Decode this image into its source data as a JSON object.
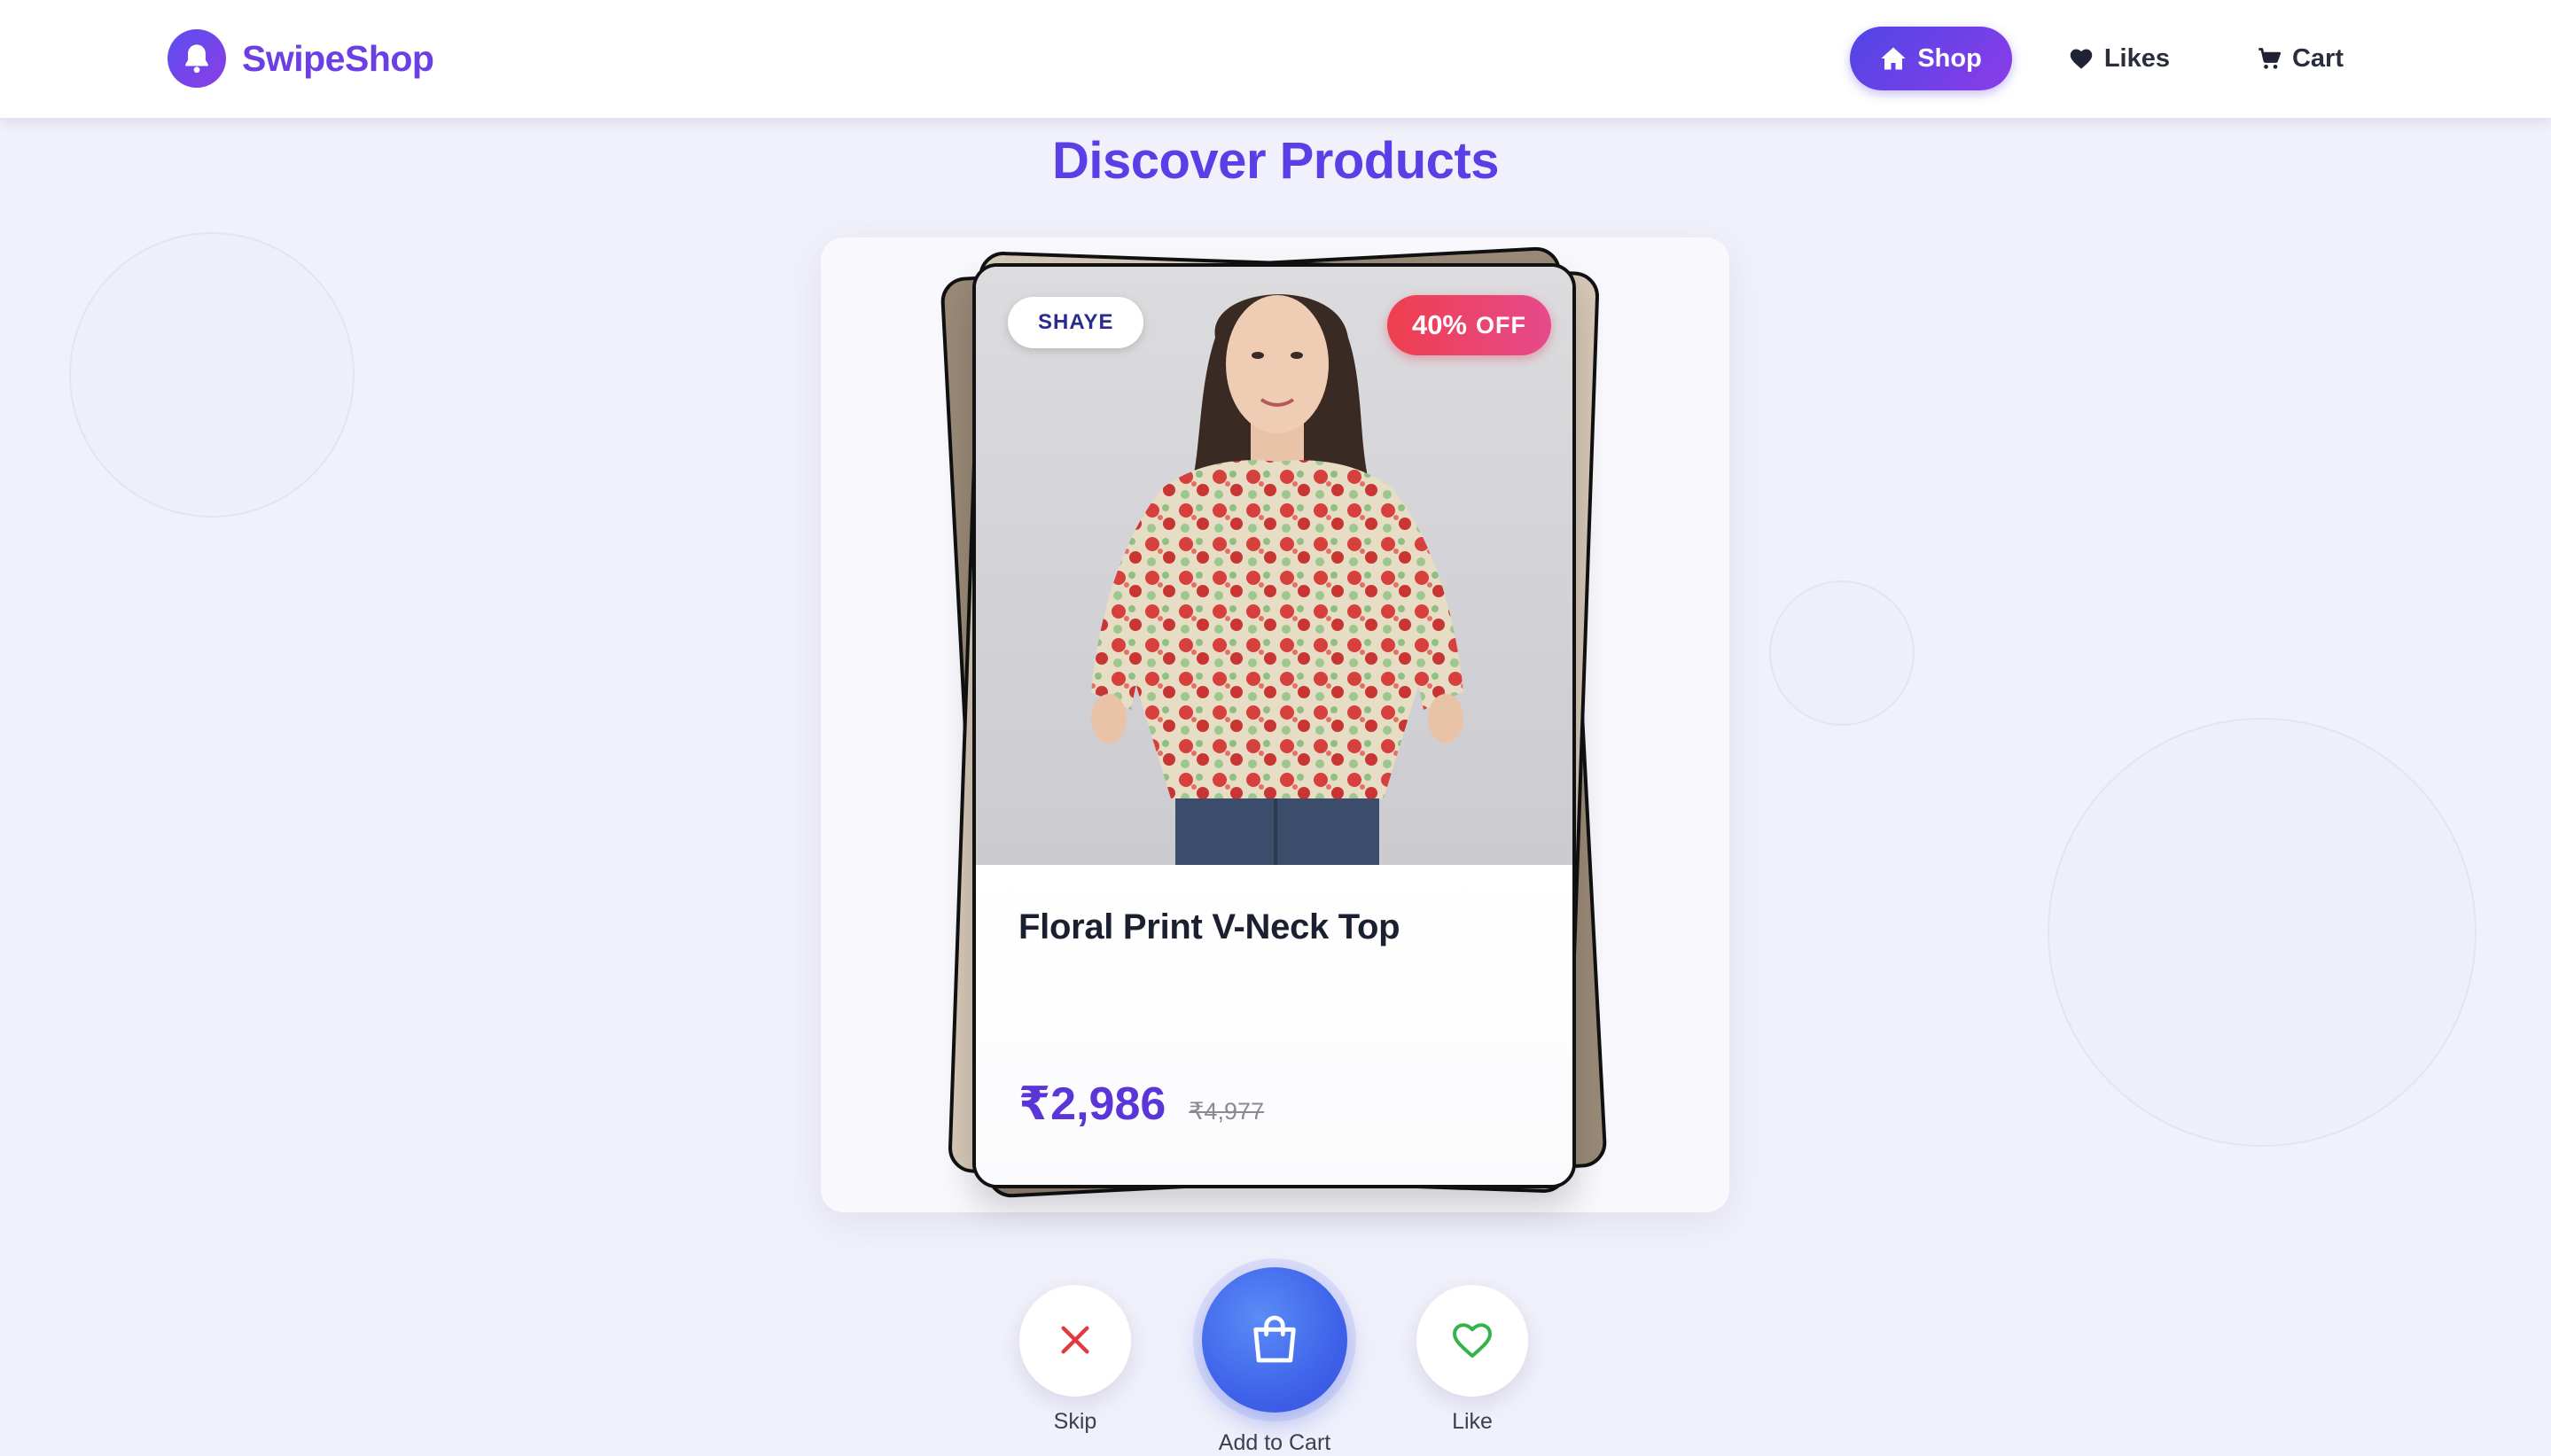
{
  "app": {
    "name": "SwipeShop",
    "accent": "#5c3ee6",
    "background": "#f1f1fb"
  },
  "nav": {
    "items": [
      {
        "label": "Shop",
        "icon": "home-icon",
        "active": true
      },
      {
        "label": "Likes",
        "icon": "heart-icon",
        "active": false
      },
      {
        "label": "Cart",
        "icon": "cart-icon",
        "active": false
      }
    ]
  },
  "page": {
    "title": "Discover Products"
  },
  "product": {
    "brand": "SHAYE",
    "discount_value": "40%",
    "discount_suffix": "OFF",
    "name": "Floral Print V-Neck Top",
    "price": "₹2,986",
    "original_price": "₹4,977",
    "image_icon": "floral-top-model-image"
  },
  "actions": {
    "skip": {
      "label": "Skip",
      "icon": "close-icon",
      "color": "#e0393e"
    },
    "add_to_cart": {
      "label": "Add to Cart",
      "icon": "shopping-bag-icon",
      "color": "#3f63ea"
    },
    "like": {
      "label": "Like",
      "icon": "heart-outline-icon",
      "color": "#34b34a"
    }
  }
}
